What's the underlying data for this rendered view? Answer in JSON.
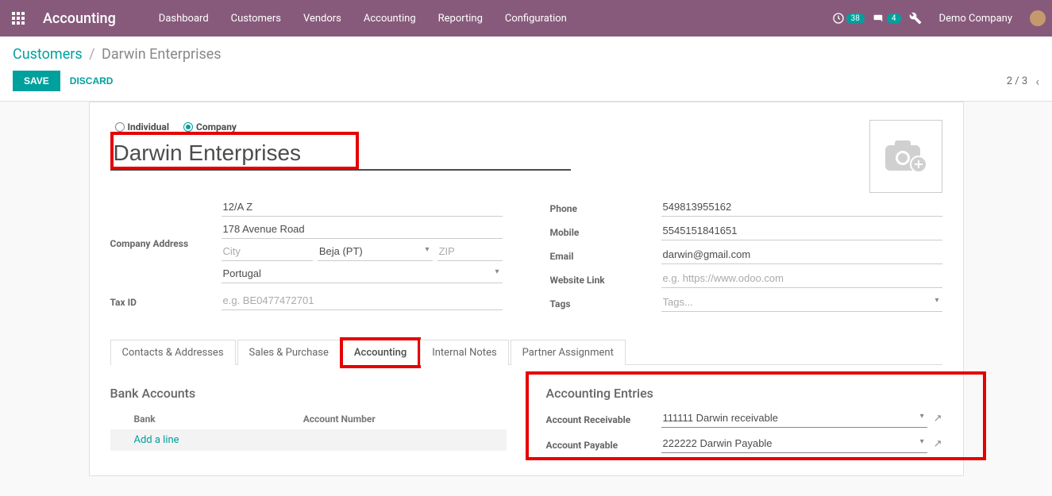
{
  "topbar": {
    "app_title": "Accounting",
    "nav": [
      "Dashboard",
      "Customers",
      "Vendors",
      "Accounting",
      "Reporting",
      "Configuration"
    ],
    "activity_count": "38",
    "msg_count": "4",
    "company": "Demo Company"
  },
  "breadcrumb": {
    "root": "Customers",
    "current": "Darwin Enterprises"
  },
  "actions": {
    "save": "SAVE",
    "discard": "DISCARD",
    "pager": "2 / 3"
  },
  "form": {
    "radios": {
      "individual": "Individual",
      "company": "Company",
      "selected": "company"
    },
    "name": "Darwin Enterprises",
    "labels": {
      "company_address": "Company Address",
      "tax_id": "Tax ID",
      "phone": "Phone",
      "mobile": "Mobile",
      "email": "Email",
      "website": "Website Link",
      "tags": "Tags"
    },
    "address": {
      "line1": "12/A Z",
      "line2": "178 Avenue Road",
      "city": "",
      "city_ph": "City",
      "state": "Beja (PT)",
      "zip": "",
      "zip_ph": "ZIP",
      "country": "Portugal"
    },
    "tax_id_value": "",
    "tax_id_ph": "e.g. BE0477472701",
    "phone": "549813955162",
    "mobile": "5545151841651",
    "email": "darwin@gmail.com",
    "website": "",
    "website_ph": "e.g. https://www.odoo.com",
    "tags": "",
    "tags_ph": "Tags..."
  },
  "tabs": {
    "items": [
      "Contacts & Addresses",
      "Sales & Purchase",
      "Accounting",
      "Internal Notes",
      "Partner Assignment"
    ],
    "active_index": 2
  },
  "bank": {
    "section": "Bank Accounts",
    "col1": "Bank",
    "col2": "Account Number",
    "add": "Add a line"
  },
  "entries": {
    "section": "Accounting Entries",
    "receivable_label": "Account Receivable",
    "payable_label": "Account Payable",
    "receivable_value": "111111 Darwin receivable",
    "payable_value": "222222 Darwin Payable"
  }
}
